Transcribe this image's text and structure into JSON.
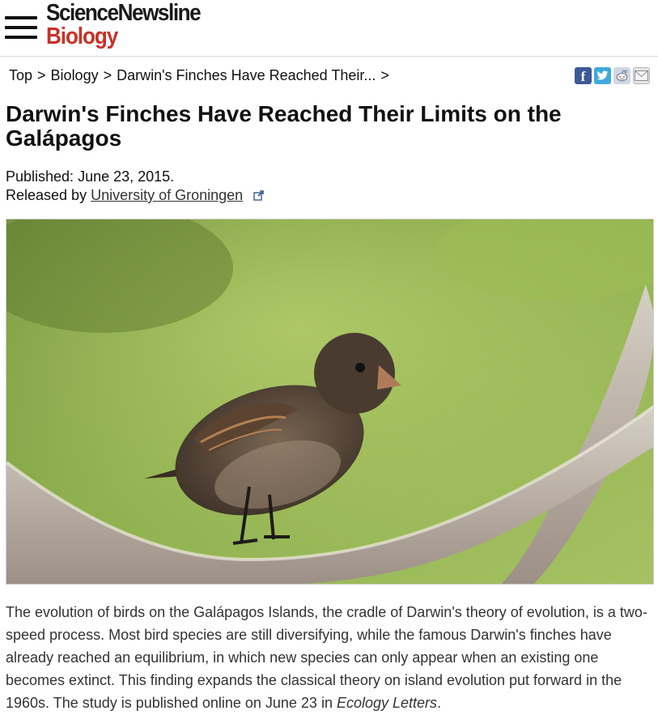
{
  "site": {
    "brand_top": "ScienceNewsline",
    "brand_section": "Biology"
  },
  "breadcrumb": {
    "items": [
      "Top",
      "Biology",
      "Darwin's Finches Have Reached Their..."
    ],
    "separator": ">"
  },
  "share": {
    "facebook": "f",
    "twitter": "t",
    "reddit": "reddit",
    "email": "email"
  },
  "article": {
    "title": "Darwin's Finches Have Reached Their Limits on the Galápagos",
    "published_label": "Published:",
    "published_date": "June 23, 2015.",
    "released_label": "Released by",
    "released_by": "University of Groningen",
    "image_alt": "Finch perched on branch",
    "body_main": "The evolution of birds on the Galápagos Islands, the cradle of Darwin's theory of evolution, is a two-speed process. Most bird species are still diversifying, while the famous Darwin's finches have already reached an equilibrium, in which new species can only appear when an existing one becomes extinct. This finding expands the classical theory on island evolution put forward in the 1960s. The study is published online on June 23 in",
    "journal": "Ecology Letters",
    "body_end": "."
  },
  "colors": {
    "brand_red": "#c8322a",
    "brand_dark": "#1a1a1a",
    "facebook": "#3b5998",
    "twitter": "#3fa9dd"
  }
}
